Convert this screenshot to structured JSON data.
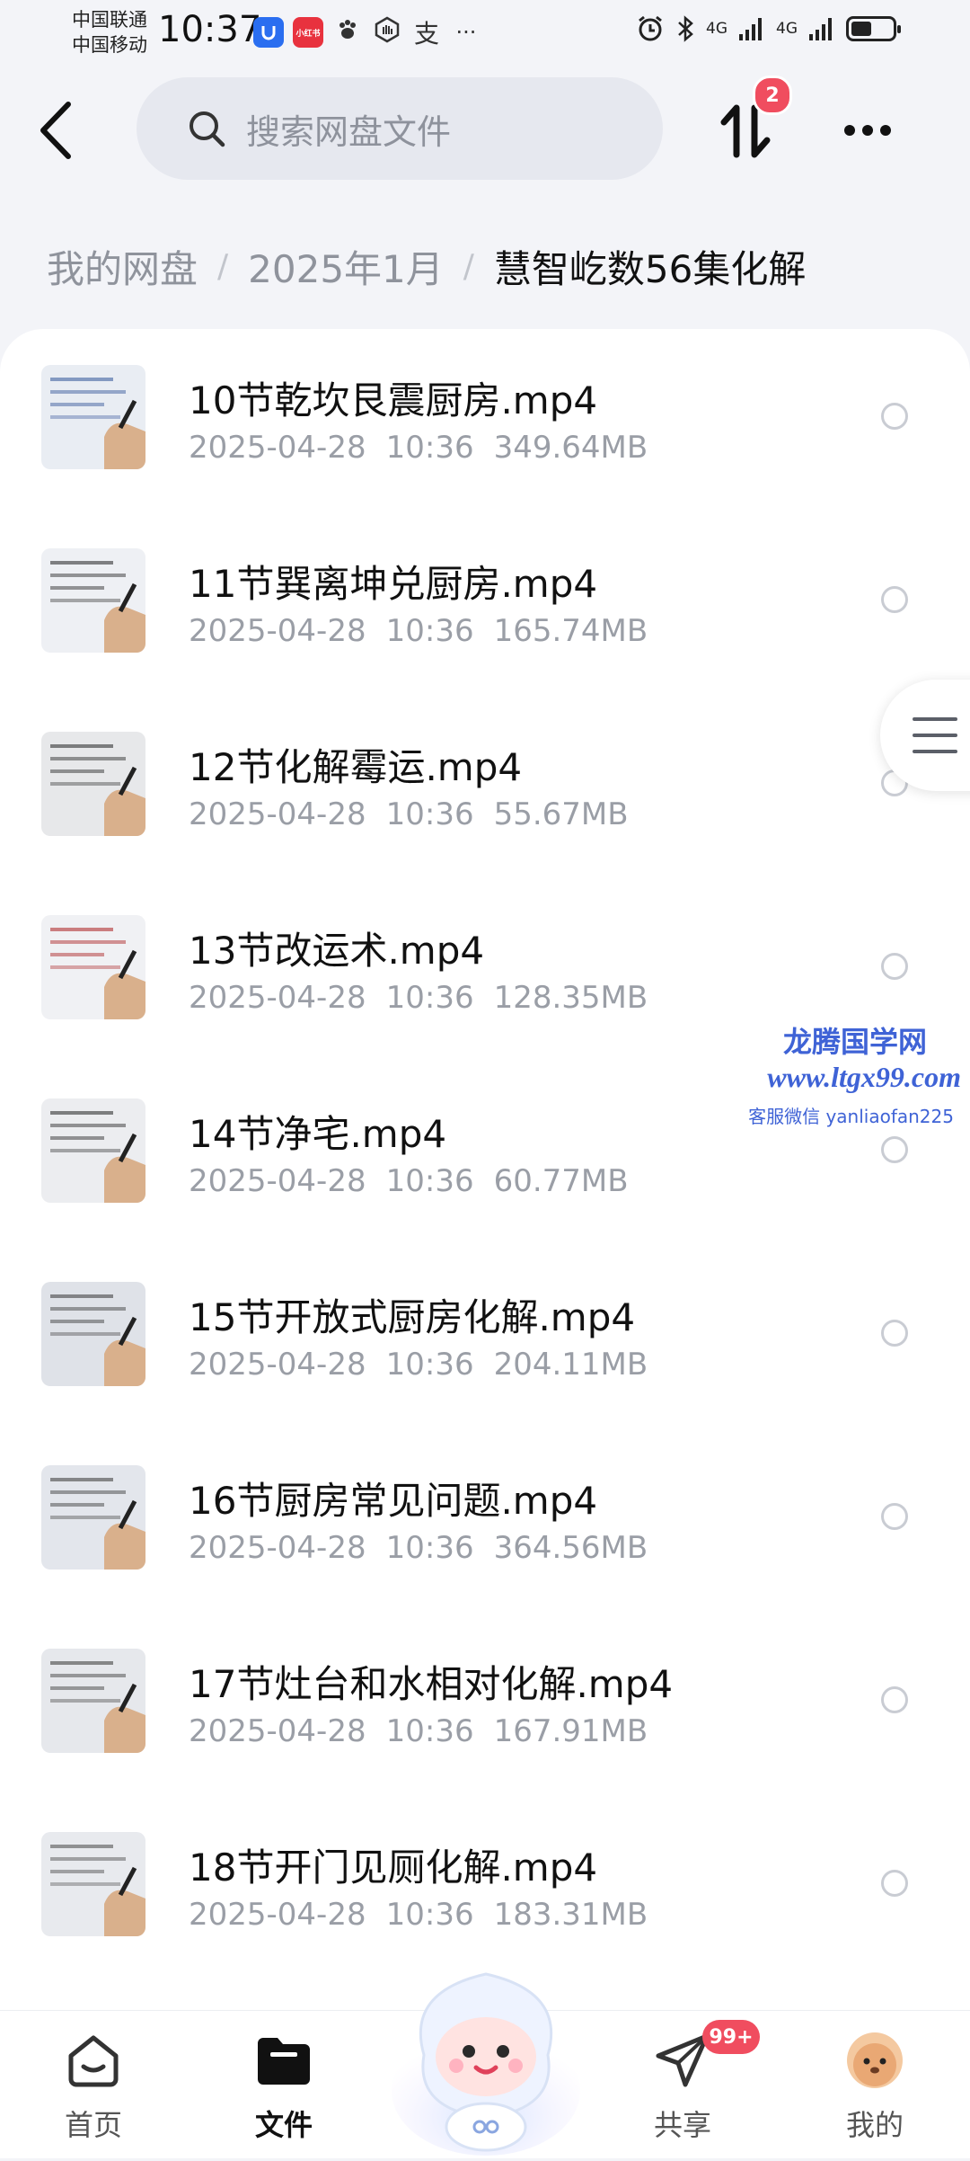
{
  "status_bar": {
    "carrier_1": "中国联通",
    "carrier_2": "中国移动",
    "time": "10:37",
    "app_badge_2": "小红书",
    "alipay_glyph": "支",
    "more_dots": "···",
    "signal_1": "4G",
    "signal_2": "4G",
    "battery_level": 0.5,
    "icons": [
      "app-badge-icon",
      "xiaohongshu-icon",
      "baidu-paw-icon",
      "hand-icon",
      "alipay-icon",
      "more-icon",
      "alarm-icon",
      "bluetooth-icon",
      "signal-icon",
      "battery-icon"
    ]
  },
  "header": {
    "search_placeholder": "搜索网盘文件",
    "transfer_badge": "2"
  },
  "breadcrumb": {
    "items": [
      "我的网盘",
      "2025年1月",
      "慧智屹数56集化解"
    ]
  },
  "files": [
    {
      "name": "10节乾坎艮震厨房.mp4",
      "date": "2025-04-28",
      "time": "10:36",
      "size": "349.64MB"
    },
    {
      "name": "11节巽离坤兑厨房.mp4",
      "date": "2025-04-28",
      "time": "10:36",
      "size": "165.74MB"
    },
    {
      "name": "12节化解霉运.mp4",
      "date": "2025-04-28",
      "time": "10:36",
      "size": "55.67MB"
    },
    {
      "name": "13节改运术.mp4",
      "date": "2025-04-28",
      "time": "10:36",
      "size": "128.35MB"
    },
    {
      "name": "14节净宅.mp4",
      "date": "2025-04-28",
      "time": "10:36",
      "size": "60.77MB"
    },
    {
      "name": "15节开放式厨房化解.mp4",
      "date": "2025-04-28",
      "time": "10:36",
      "size": "204.11MB"
    },
    {
      "name": "16节厨房常见问题.mp4",
      "date": "2025-04-28",
      "time": "10:36",
      "size": "364.56MB"
    },
    {
      "name": "17节灶台和水相对化解.mp4",
      "date": "2025-04-28",
      "time": "10:36",
      "size": "167.91MB"
    },
    {
      "name": "18节开门见厕化解.mp4",
      "date": "2025-04-28",
      "time": "10:36",
      "size": "183.31MB"
    }
  ],
  "watermark": {
    "line1": "龙腾国学网",
    "line2": "www.ltgx99.com",
    "line3": "客服微信 yanliaofan225"
  },
  "bottom_nav": {
    "items": [
      {
        "label": "首页",
        "icon": "home-icon"
      },
      {
        "label": "文件",
        "icon": "folder-icon"
      },
      {
        "label": "共享",
        "icon": "share-plane-icon"
      },
      {
        "label": "我的",
        "icon": "avatar-icon"
      }
    ],
    "share_badge": "99+",
    "active": "文件"
  },
  "colors": {
    "accent_red": "#f04d5f",
    "text_primary": "#111111",
    "text_secondary": "#9a9ea6",
    "watermark_blue": "#3f63d6"
  }
}
